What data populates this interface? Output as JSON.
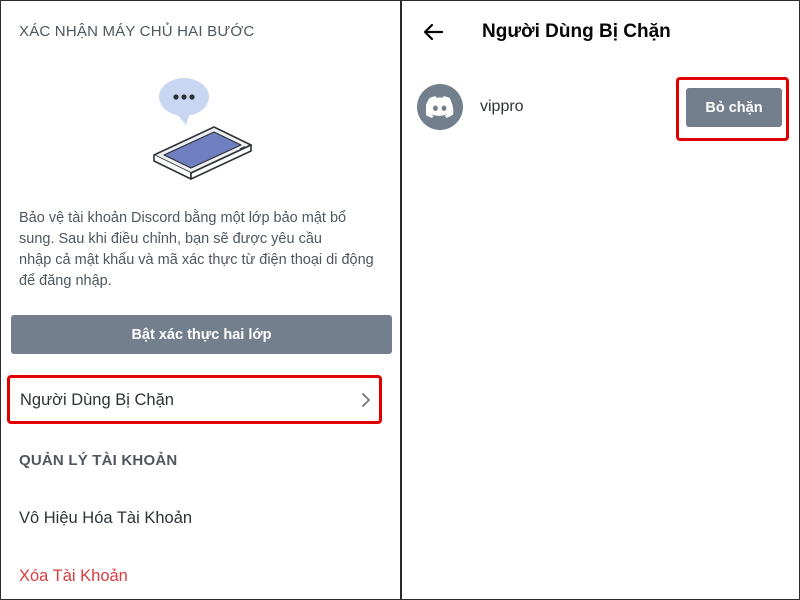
{
  "left_panel": {
    "two_step_section_title": "XÁC NHẬN MÁY CHỦ HAI BƯỚC",
    "description_lines": [
      "Bảo vệ tài khoản Discord bằng một lớp bảo mật bổ",
      "sung. Sau khi điều chỉnh, bạn sẽ được yêu cầu",
      "nhập cả mật khẩu và mã xác thực từ điện thoại di động",
      "để đăng nhập."
    ],
    "enable_2fa_button": "Bật xác thực hai lớp",
    "blocked_users_row": "Người Dùng Bị Chặn",
    "account_management_title": "QUẢN LÝ TÀI KHOẢN",
    "disable_account": "Vô Hiệu Hóa Tài Khoản",
    "delete_account": "Xóa Tài Khoản"
  },
  "right_panel": {
    "title": "Người Dùng Bị Chặn",
    "blocked_user": {
      "username": "vippro",
      "avatar_icon": "discord-logo-icon",
      "unblock_button": "Bỏ chặn"
    }
  },
  "colors": {
    "button_gray": "#747f8d",
    "highlight_red": "#e00000",
    "danger_red": "#d83c3e"
  }
}
